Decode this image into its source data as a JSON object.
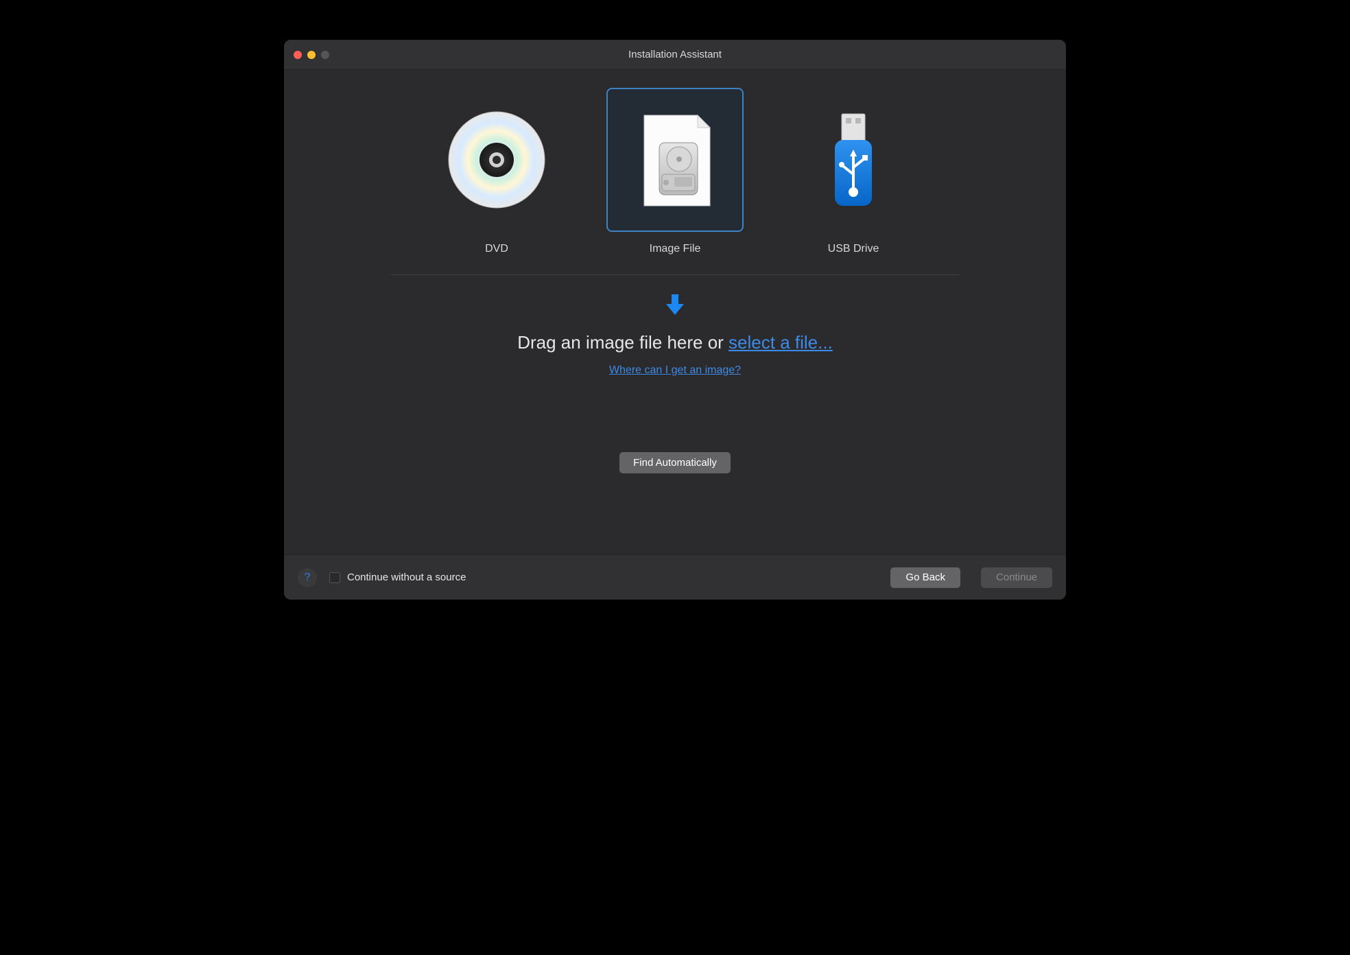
{
  "window": {
    "title": "Installation Assistant"
  },
  "options": {
    "dvd": "DVD",
    "image_file": "Image File",
    "usb_drive": "USB Drive"
  },
  "dropzone": {
    "prompt_prefix": "Drag an image file here or ",
    "select_link": "select a file...",
    "help_link": "Where can I get an image?"
  },
  "buttons": {
    "find_auto": "Find Automatically",
    "go_back": "Go Back",
    "continue": "Continue"
  },
  "footer": {
    "continue_without": "Continue without a source"
  },
  "colors": {
    "accent": "#3d8be8"
  }
}
